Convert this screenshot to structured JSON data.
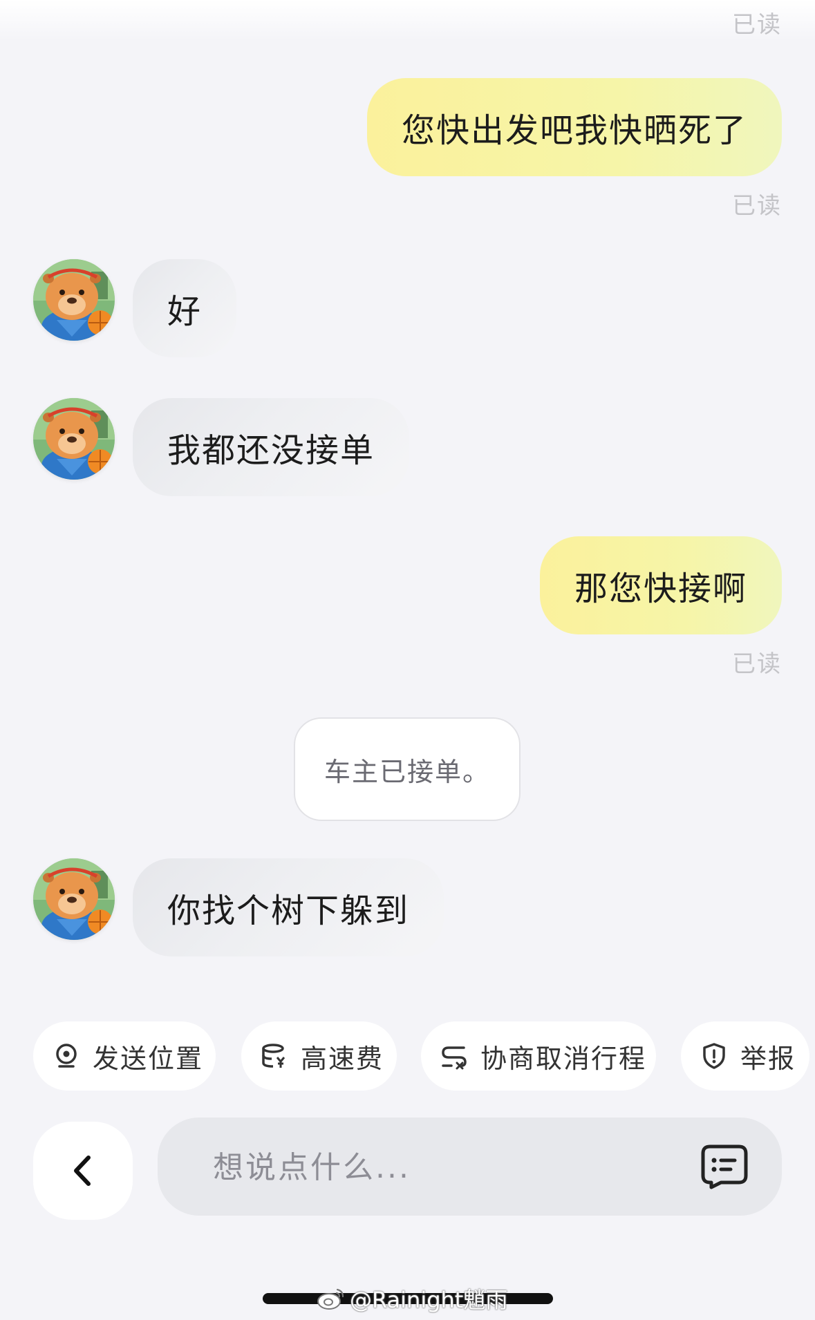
{
  "messages": {
    "read_top": "已读",
    "m1": {
      "text": "您快出发吧我快晒死了",
      "read": "已读"
    },
    "m2": {
      "text": "好"
    },
    "m3": {
      "text": "我都还没接单"
    },
    "m4": {
      "text": "那您快接啊",
      "read": "已读"
    },
    "system": "车主已接单。",
    "m5": {
      "text": "你找个树下躲到"
    }
  },
  "quick_actions": [
    {
      "label": "发送位置",
      "icon": "location-icon"
    },
    {
      "label": "高速费",
      "icon": "toll-fee-icon"
    },
    {
      "label": "协商取消行程",
      "icon": "cancel-route-icon"
    },
    {
      "label": "举报",
      "icon": "shield-report-icon"
    }
  ],
  "composer": {
    "placeholder": "想说点什么..."
  },
  "watermark": "@Rainight魈雨",
  "colors": {
    "outgoing_bubble": "#fbf19c",
    "incoming_bubble": "#eceef1",
    "background": "#f4f4f8"
  }
}
